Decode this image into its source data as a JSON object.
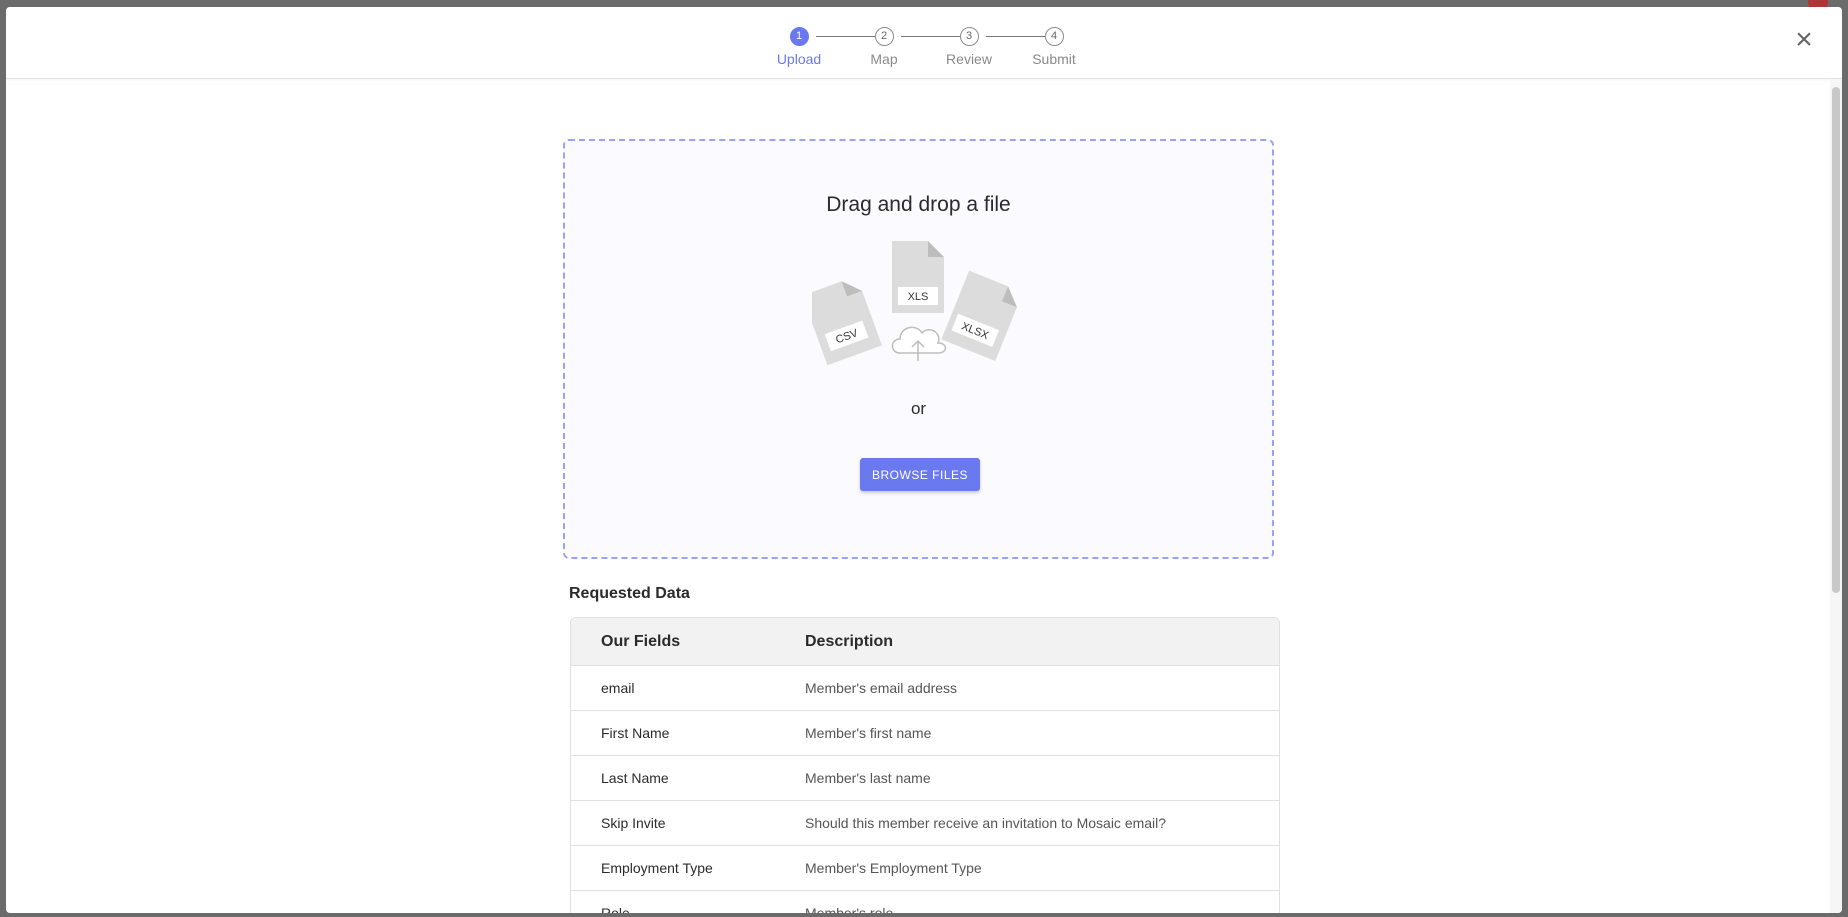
{
  "stepper": {
    "steps": [
      {
        "number": "1",
        "label": "Upload",
        "active": true
      },
      {
        "number": "2",
        "label": "Map",
        "active": false
      },
      {
        "number": "3",
        "label": "Review",
        "active": false
      },
      {
        "number": "4",
        "label": "Submit",
        "active": false
      }
    ]
  },
  "close_icon": "×",
  "dropzone": {
    "title": "Drag and drop a file",
    "file_types": [
      "CSV",
      "XLS",
      "XLSX"
    ],
    "or_text": "or",
    "browse_label": "BROWSE FILES"
  },
  "requested_data": {
    "title": "Requested Data",
    "columns": [
      "Our Fields",
      "Description"
    ],
    "rows": [
      {
        "field": "email",
        "description": "Member's email address"
      },
      {
        "field": "First Name",
        "description": "Member's first name"
      },
      {
        "field": "Last Name",
        "description": "Member's last name"
      },
      {
        "field": "Skip Invite",
        "description": "Should this member receive an invitation to Mosaic email?"
      },
      {
        "field": "Employment Type",
        "description": "Member's Employment Type"
      },
      {
        "field": "Role",
        "description": "Member's role"
      }
    ]
  },
  "colors": {
    "accent": "#6b79f0",
    "dropzone_border": "#9aa3f2",
    "backdrop": "#6b6b6b"
  }
}
